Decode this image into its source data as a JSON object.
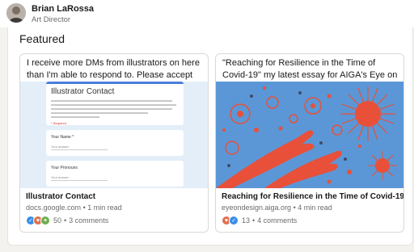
{
  "profile": {
    "name": "Brian LaRossa",
    "role": "Art Director"
  },
  "featured": {
    "title": "Featured",
    "cards": [
      {
        "description": "I receive more DMs from illustrators on here than I'm able to respond to. Please accept my apologies if…",
        "title": "Illustrator Contact",
        "source": "docs.google.com",
        "read_time": "1 min read",
        "reactions_count": "50",
        "comments": "3 comments",
        "image": {
          "form_title": "Illustrator Contact",
          "required_note": "* Required",
          "q1_label": "Your Name *",
          "q1_placeholder": "Your answer",
          "q2_label": "Your Pronouns",
          "q2_placeholder": "Your answer"
        }
      },
      {
        "description": "\"Reaching for Resilience in the Time of Covid-19\" my latest essay for AIGA's Eye on Design about…",
        "title": "Reaching for Resilience in the Time of Covid-19",
        "source": "eyeondesign.aiga.org",
        "read_time": "4 min read",
        "reactions_count": "13",
        "comments": "4 comments"
      }
    ]
  },
  "colors": {
    "illustration_bg": "#5b97d6",
    "illustration_red": "#e8503a",
    "form_accent": "#4a7ed8",
    "like_blue": "#378fe9",
    "love_red": "#df704d",
    "support_purple": "#9c6ade",
    "celebrate_green": "#6dae4f"
  },
  "dot_separator": "•"
}
